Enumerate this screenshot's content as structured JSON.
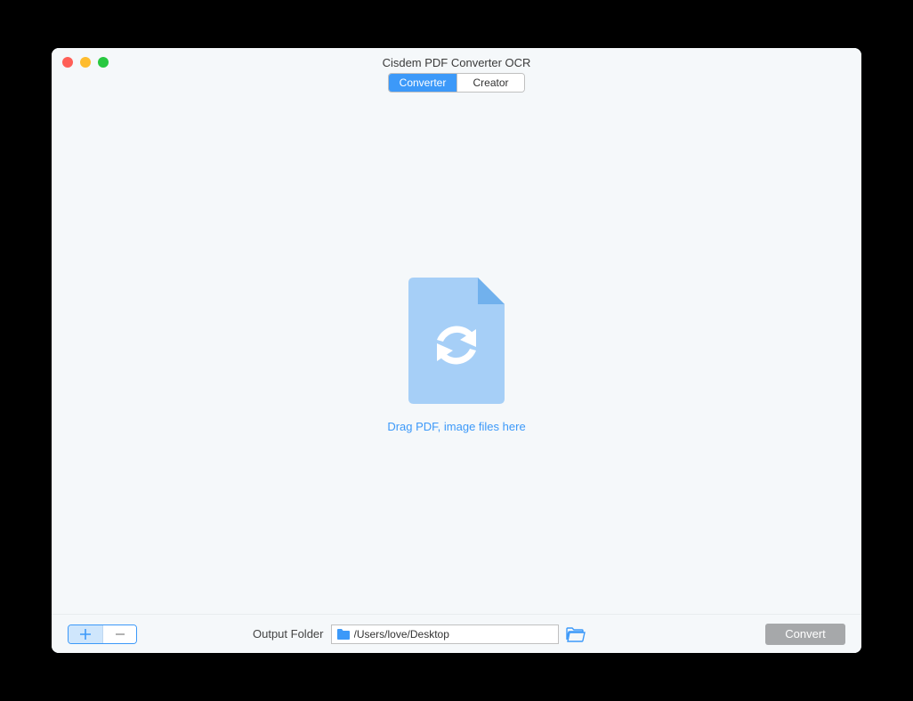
{
  "window": {
    "title": "Cisdem PDF Converter OCR"
  },
  "tabs": {
    "converter": "Converter",
    "creator": "Creator"
  },
  "dropzone": {
    "hint": "Drag PDF, image files here"
  },
  "bottom": {
    "output_label": "Output Folder",
    "output_path": "/Users/love/Desktop",
    "convert_label": "Convert"
  }
}
